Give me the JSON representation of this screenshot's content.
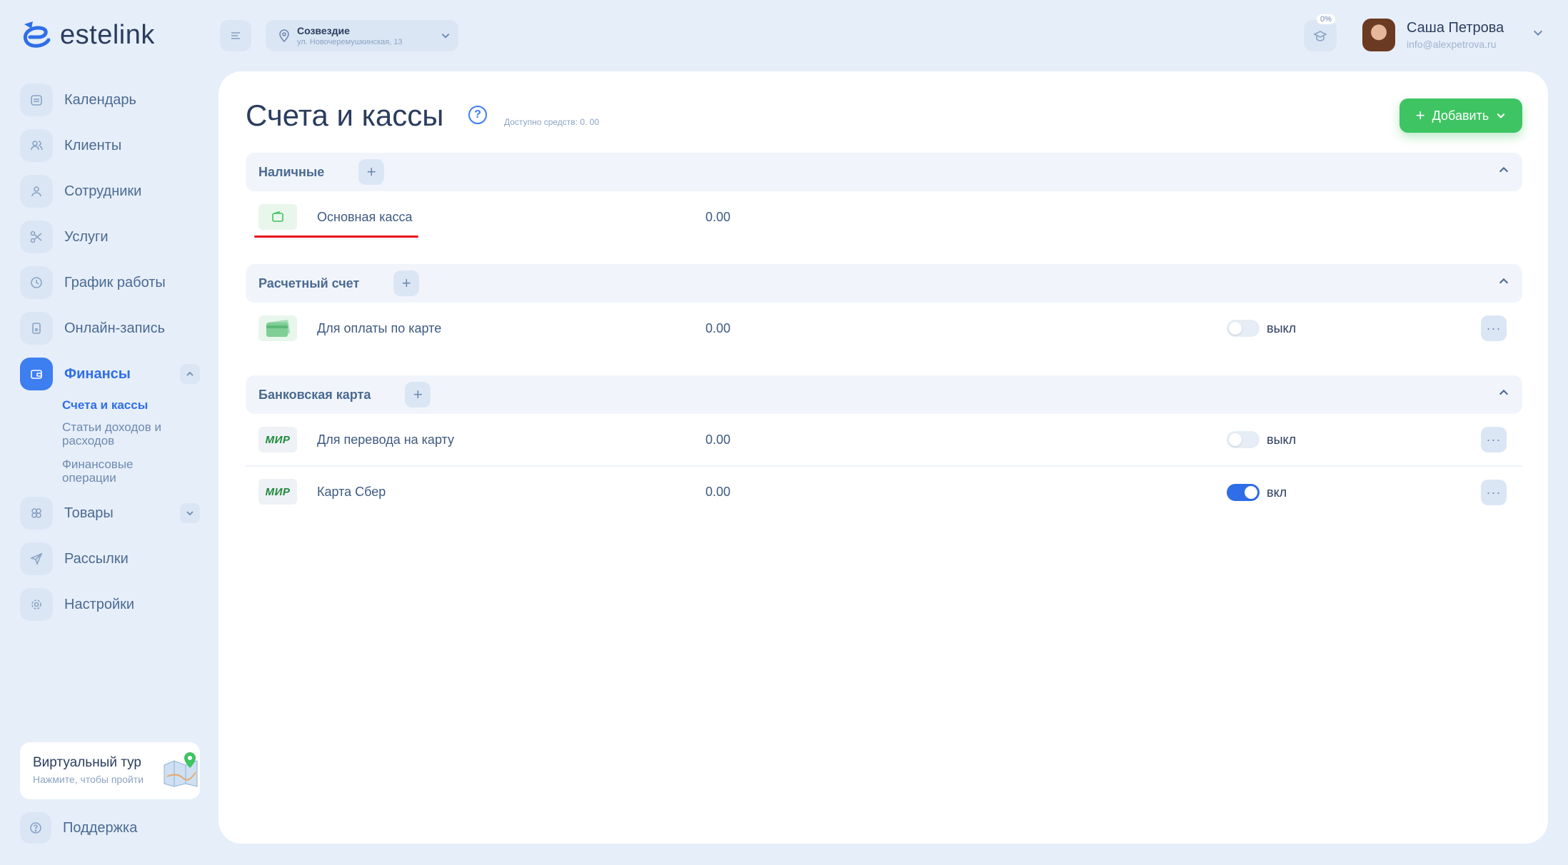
{
  "brand": {
    "name": "estelink"
  },
  "sidebar": {
    "items": [
      {
        "label": "Календарь",
        "icon": "calendar-icon"
      },
      {
        "label": "Клиенты",
        "icon": "clients-icon"
      },
      {
        "label": "Сотрудники",
        "icon": "employee-icon"
      },
      {
        "label": "Услуги",
        "icon": "scissors-icon"
      },
      {
        "label": "График работы",
        "icon": "clock-icon"
      },
      {
        "label": "Онлайн-запись",
        "icon": "phone-icon"
      },
      {
        "label": "Финансы",
        "icon": "wallet-icon",
        "expanded": true
      },
      {
        "label": "Товары",
        "icon": "goods-icon"
      },
      {
        "label": "Рассылки",
        "icon": "send-icon"
      },
      {
        "label": "Настройки",
        "icon": "gear-icon"
      }
    ],
    "finance_sub": [
      "Счета и кассы",
      "Статьи доходов и расходов",
      "Финансовые операции"
    ],
    "tour": {
      "title": "Виртуальный тур",
      "subtitle": "Нажмите, чтобы пройти"
    },
    "support": "Поддержка"
  },
  "header": {
    "location": {
      "name": "Созвездие",
      "address": "ул. Новочеремушкинская, 13"
    },
    "progress": "0%",
    "user": {
      "name": "Саша Петрова",
      "email": "info@alexpetrova.ru"
    }
  },
  "page": {
    "title": "Счета и кассы",
    "available": "Доступно средств: 0. 00",
    "add_label": "Добавить"
  },
  "groups": [
    {
      "title": "Наличные",
      "rows": [
        {
          "name": "Основная касса",
          "sum": "0.00",
          "icon": "wallet-icon"
        }
      ]
    },
    {
      "title": "Расчетный счет",
      "rows": [
        {
          "name": "Для оплаты по карте",
          "sum": "0.00",
          "icon": "card-icon",
          "state": "выкл",
          "on": false
        }
      ]
    },
    {
      "title": "Банковская карта",
      "rows": [
        {
          "name": "Для перевода на карту",
          "sum": "0.00",
          "icon": "МИР",
          "state": "выкл",
          "on": false
        },
        {
          "name": "Карта Сбер",
          "sum": "0.00",
          "icon": "МИР",
          "state": "вкл",
          "on": true
        }
      ]
    }
  ],
  "colors": {
    "accent": "#3d7ef0",
    "add": "#3ec462",
    "background": "#e6eef9",
    "underline": "#e8141b"
  }
}
